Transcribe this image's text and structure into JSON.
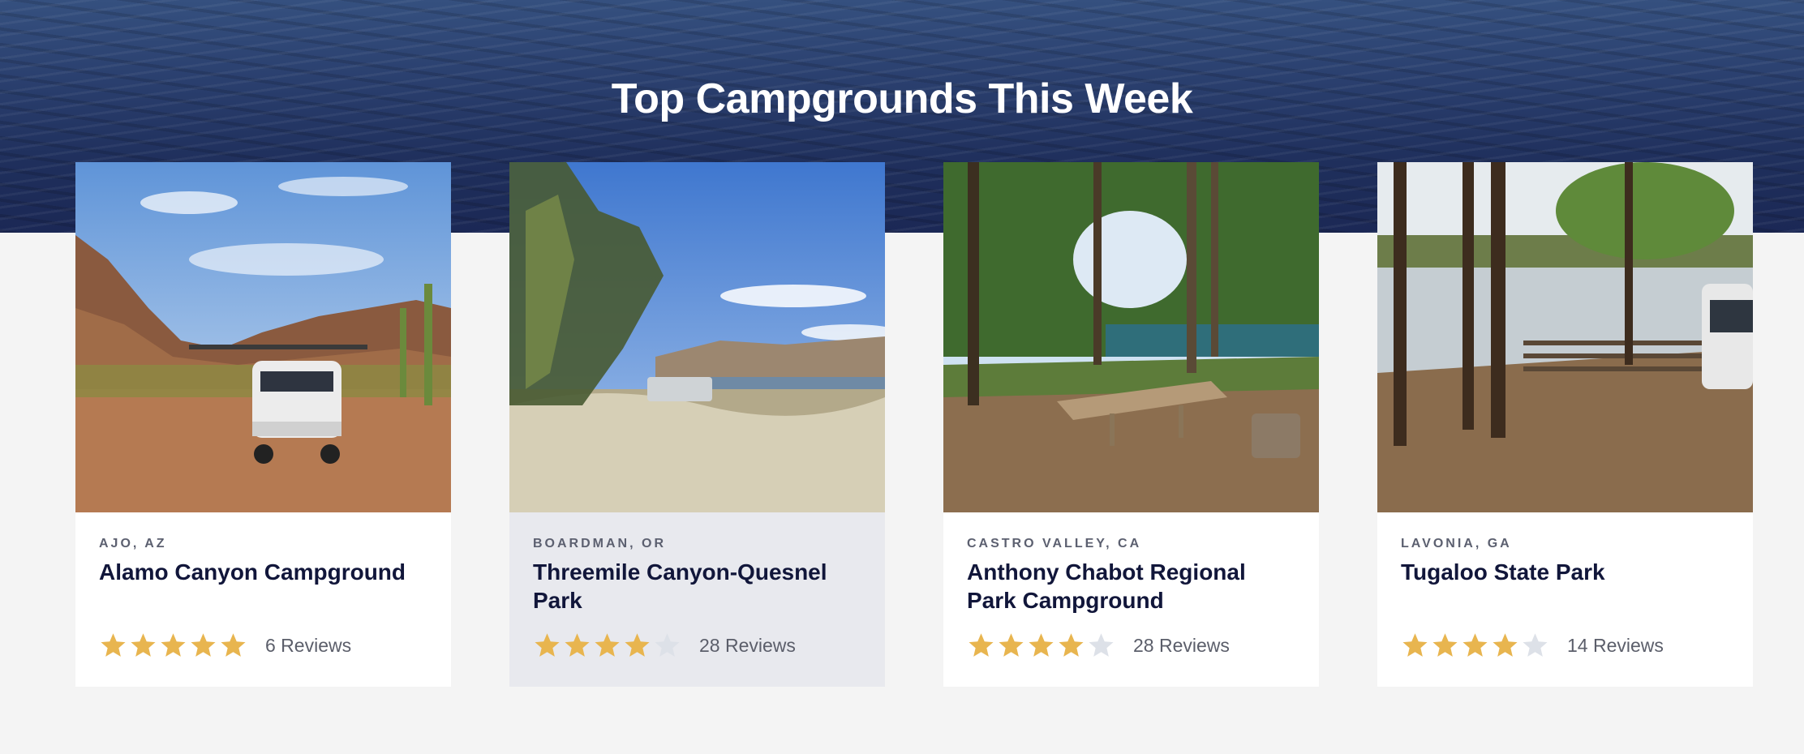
{
  "hero": {
    "title": "Top Campgrounds This Week"
  },
  "colors": {
    "star_filled": "#e8b54f",
    "star_empty": "#dde1e8",
    "hero_water": "#1f2f5c",
    "name_text": "#11163a",
    "location_text": "#5c6070"
  },
  "cards": [
    {
      "location": "AJO, AZ",
      "name": "Alamo Canyon Campground",
      "rating": 5,
      "reviews": "6 Reviews",
      "photo_icon": "desert-campsite-photo"
    },
    {
      "location": "BOARDMAN, OR",
      "name": "Threemile Canyon-Quesnel Park",
      "rating": 4,
      "reviews": "28 Reviews",
      "photo_icon": "river-grass-photo"
    },
    {
      "location": "CASTRO VALLEY, CA",
      "name": "Anthony Chabot Regional Park Campground",
      "rating": 4,
      "reviews": "28 Reviews",
      "photo_icon": "picnic-table-photo"
    },
    {
      "location": "LAVONIA, GA",
      "name": "Tugaloo State Park",
      "rating": 4,
      "reviews": "14 Reviews",
      "photo_icon": "lake-pines-photo"
    }
  ]
}
